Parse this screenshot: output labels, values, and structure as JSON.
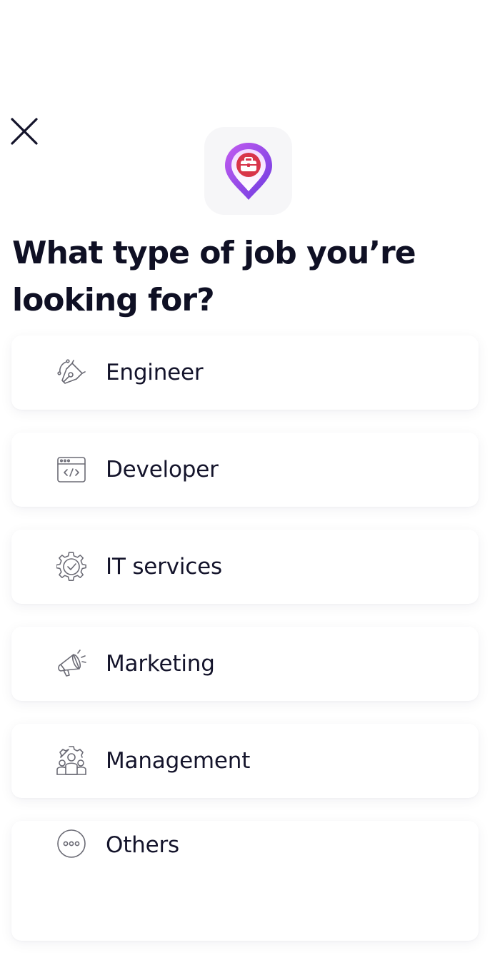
{
  "header": {
    "close_icon": "close-icon",
    "logo_icon": "location-pin-briefcase-icon"
  },
  "title": "What type of job you’re looking for?",
  "options": [
    {
      "label": "Engineer",
      "icon": "pen-tool-icon"
    },
    {
      "label": "Developer",
      "icon": "code-window-icon"
    },
    {
      "label": "IT services",
      "icon": "gear-check-icon"
    },
    {
      "label": "Marketing",
      "icon": "megaphone-icon"
    },
    {
      "label": "Management",
      "icon": "team-gear-icon"
    },
    {
      "label": "Others",
      "icon": "more-dots-icon"
    }
  ],
  "colors": {
    "title": "#0f1024",
    "icon_stroke": "#6b6b75",
    "logo_bg": "#f6f6f8",
    "pin_gradient_start": "#c35cf0",
    "pin_gradient_end": "#7b3fe4",
    "briefcase": "#d8344a"
  }
}
